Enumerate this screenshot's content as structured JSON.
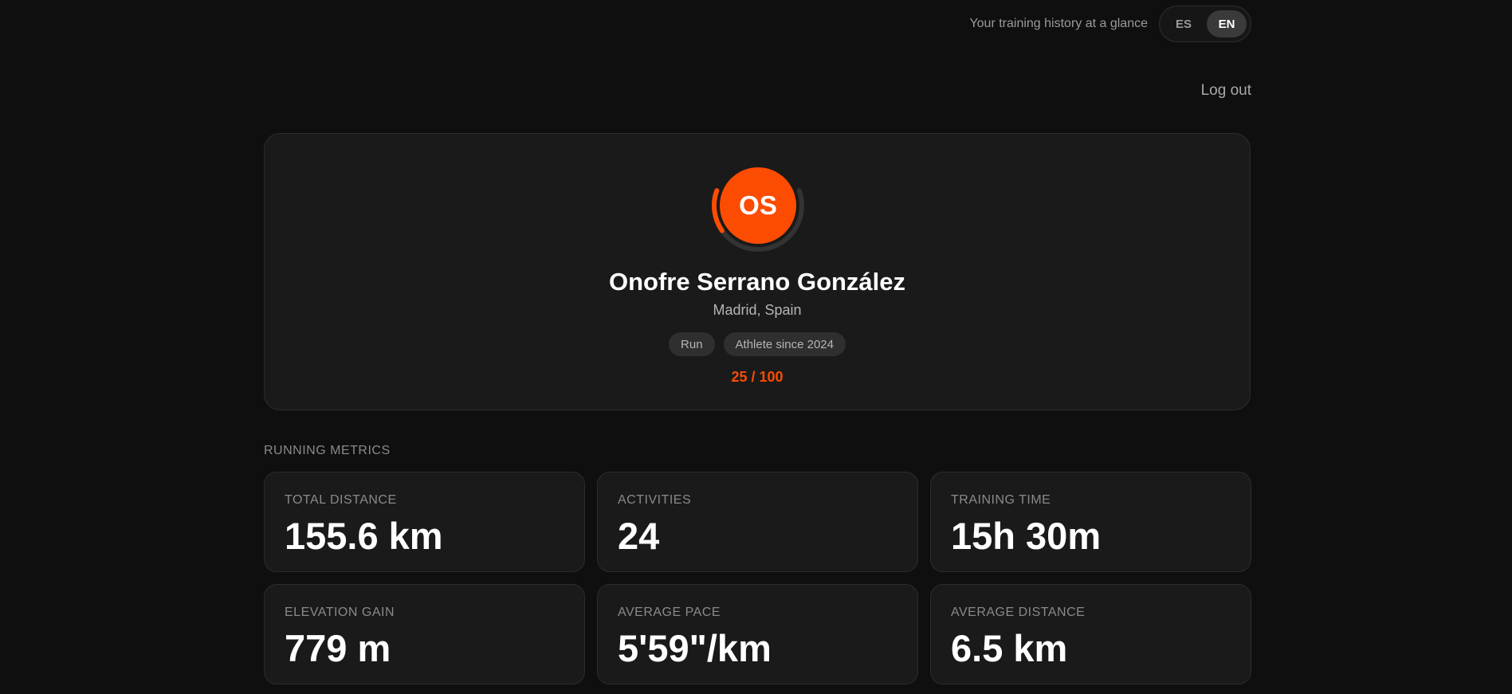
{
  "header": {
    "tagline": "Your training history at a glance",
    "languages": [
      {
        "code": "ES",
        "active": false
      },
      {
        "code": "EN",
        "active": true
      }
    ],
    "logout_label": "Log out"
  },
  "profile": {
    "initials": "OS",
    "avatar_color": "#fc4c02",
    "name": "Onofre Serrano González",
    "location": "Madrid, Spain",
    "tags": [
      "Run",
      "Athlete since 2024"
    ],
    "progress_text": "25 / 100",
    "progress_fraction": 0.25,
    "accent_color": "#fc4c02"
  },
  "metrics": {
    "section_title": "RUNNING METRICS",
    "items": [
      {
        "label": "TOTAL DISTANCE",
        "value": "155.6 km"
      },
      {
        "label": "ACTIVITIES",
        "value": "24"
      },
      {
        "label": "TRAINING TIME",
        "value": "15h 30m"
      },
      {
        "label": "ELEVATION GAIN",
        "value": "779 m"
      },
      {
        "label": "AVERAGE PACE",
        "value": "5'59\"/km"
      },
      {
        "label": "AVERAGE DISTANCE",
        "value": "6.5 km"
      }
    ]
  }
}
